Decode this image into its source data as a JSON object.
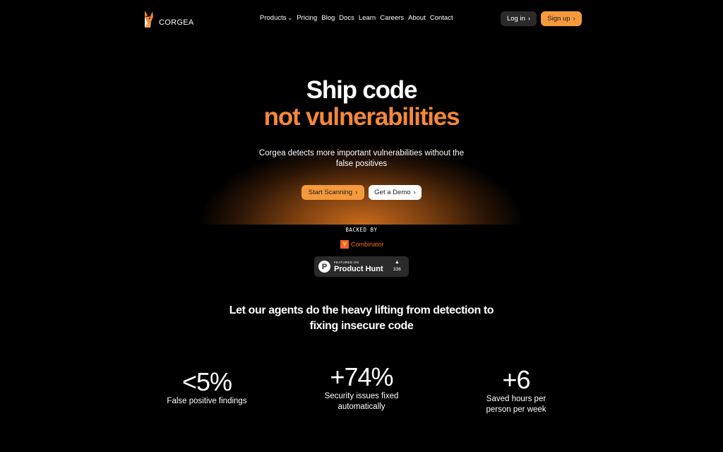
{
  "brand": {
    "name": "CORGEA"
  },
  "nav": {
    "links": [
      "Products",
      "Pricing",
      "Blog",
      "Docs",
      "Learn",
      "Careers",
      "About",
      "Contact"
    ],
    "login_label": "Log in",
    "signup_label": "Sign up"
  },
  "hero": {
    "line1": "Ship code",
    "line2": "not vulnerabilities",
    "subtitle": "Corgea detects more important vulnerabilities without the false positives",
    "primary_cta": "Start Scanning",
    "secondary_cta": "Get a Demo",
    "accent_color": "#f5883a"
  },
  "backed": {
    "label": "BACKED BY",
    "yc_letter": "Y",
    "yc_name": "Combinator",
    "product_hunt": {
      "featured": "FEATURED ON",
      "name": "Product Hunt",
      "icon_letter": "P",
      "votes": "336"
    }
  },
  "agents": {
    "heading": "Let our agents do the heavy lifting from detection to fixing insecure code"
  },
  "stats": [
    {
      "value": "<5%",
      "label": "False positive findings"
    },
    {
      "value": "+74%",
      "label": "Security issues fixed automatically"
    },
    {
      "value": "+6",
      "label": "Saved hours per person per week"
    }
  ]
}
